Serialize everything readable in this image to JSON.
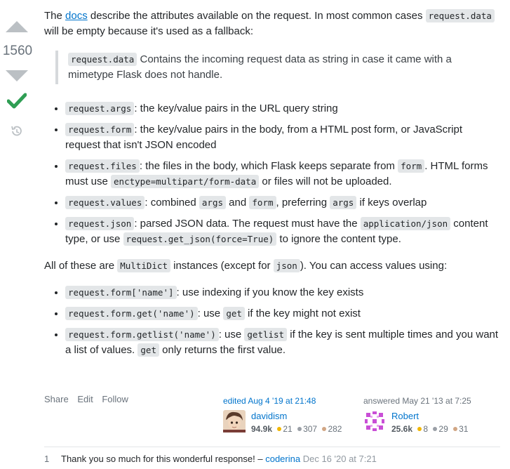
{
  "vote": {
    "count": "1560"
  },
  "post": {
    "intro_pre": "The ",
    "intro_link": "docs",
    "intro_post": " describe the attributes available on the request. In most common cases ",
    "intro_code": "request.data",
    "intro_tail": " will be empty because it's used as a fallback:",
    "quote_code": "request.data",
    "quote_text": " Contains the incoming request data as string in case it came with a mimetype Flask does not handle.",
    "items": {
      "args": {
        "code": "request.args",
        "text": ": the key/value pairs in the URL query string"
      },
      "form": {
        "code": "request.form",
        "text": ": the key/value pairs in the body, from a HTML post form, or JavaScript request that isn't JSON encoded"
      },
      "files": {
        "code": "request.files",
        "t1": ": the files in the body, which Flask keeps separate from ",
        "c2": "form",
        "t2": ". HTML forms must use ",
        "c3": "enctype=multipart/form-data",
        "t3": " or files will not be uploaded."
      },
      "values": {
        "code": "request.values",
        "t1": ": combined ",
        "c2": "args",
        "t2": " and ",
        "c3": "form",
        "t3": ", preferring ",
        "c4": "args",
        "t4": " if keys overlap"
      },
      "json": {
        "code": "request.json",
        "t1": ": parsed JSON data. The request must have the ",
        "c2": "application/json",
        "t2": " content type, or use ",
        "c3": "request.get_json(force=True)",
        "t3": " to ignore the content type."
      }
    },
    "p2_pre": "All of these are ",
    "p2_code": "MultiDict",
    "p2_mid": " instances (except for ",
    "p2_code2": "json",
    "p2_tail": "). You can access values using:",
    "access": {
      "a1": {
        "code": "request.form['name']",
        "text": ": use indexing if you know the key exists"
      },
      "a2": {
        "code": "request.form.get('name')",
        "t1": ": use ",
        "c2": "get",
        "t2": " if the key might not exist"
      },
      "a3": {
        "code": "request.form.getlist('name')",
        "t1": ": use ",
        "c2": "getlist",
        "t2": " if the key is sent multiple times and you want a list of values. ",
        "c3": "get",
        "t3": " only returns the first value."
      }
    }
  },
  "actions": {
    "share": "Share",
    "edit": "Edit",
    "follow": "Follow"
  },
  "editor": {
    "when": "edited Aug 4 '19 at 21:48",
    "name": "davidism",
    "rep": "94.9k",
    "gold": "21",
    "silver": "307",
    "bronze": "282"
  },
  "author": {
    "when": "answered May 21 '13 at 7:25",
    "name": "Robert",
    "rep": "25.6k",
    "gold": "8",
    "silver": "29",
    "bronze": "31"
  },
  "comment": {
    "score": "1",
    "text": "Thank you so much for this wonderful response! – ",
    "user": "coderina",
    "date": "Dec 16 '20 at 7:21"
  },
  "colors": {
    "gold": "#f1b600",
    "silver": "#9a9fa6",
    "bronze": "#d1a684",
    "accept": "#2f9e54",
    "link": "#0074cc"
  }
}
